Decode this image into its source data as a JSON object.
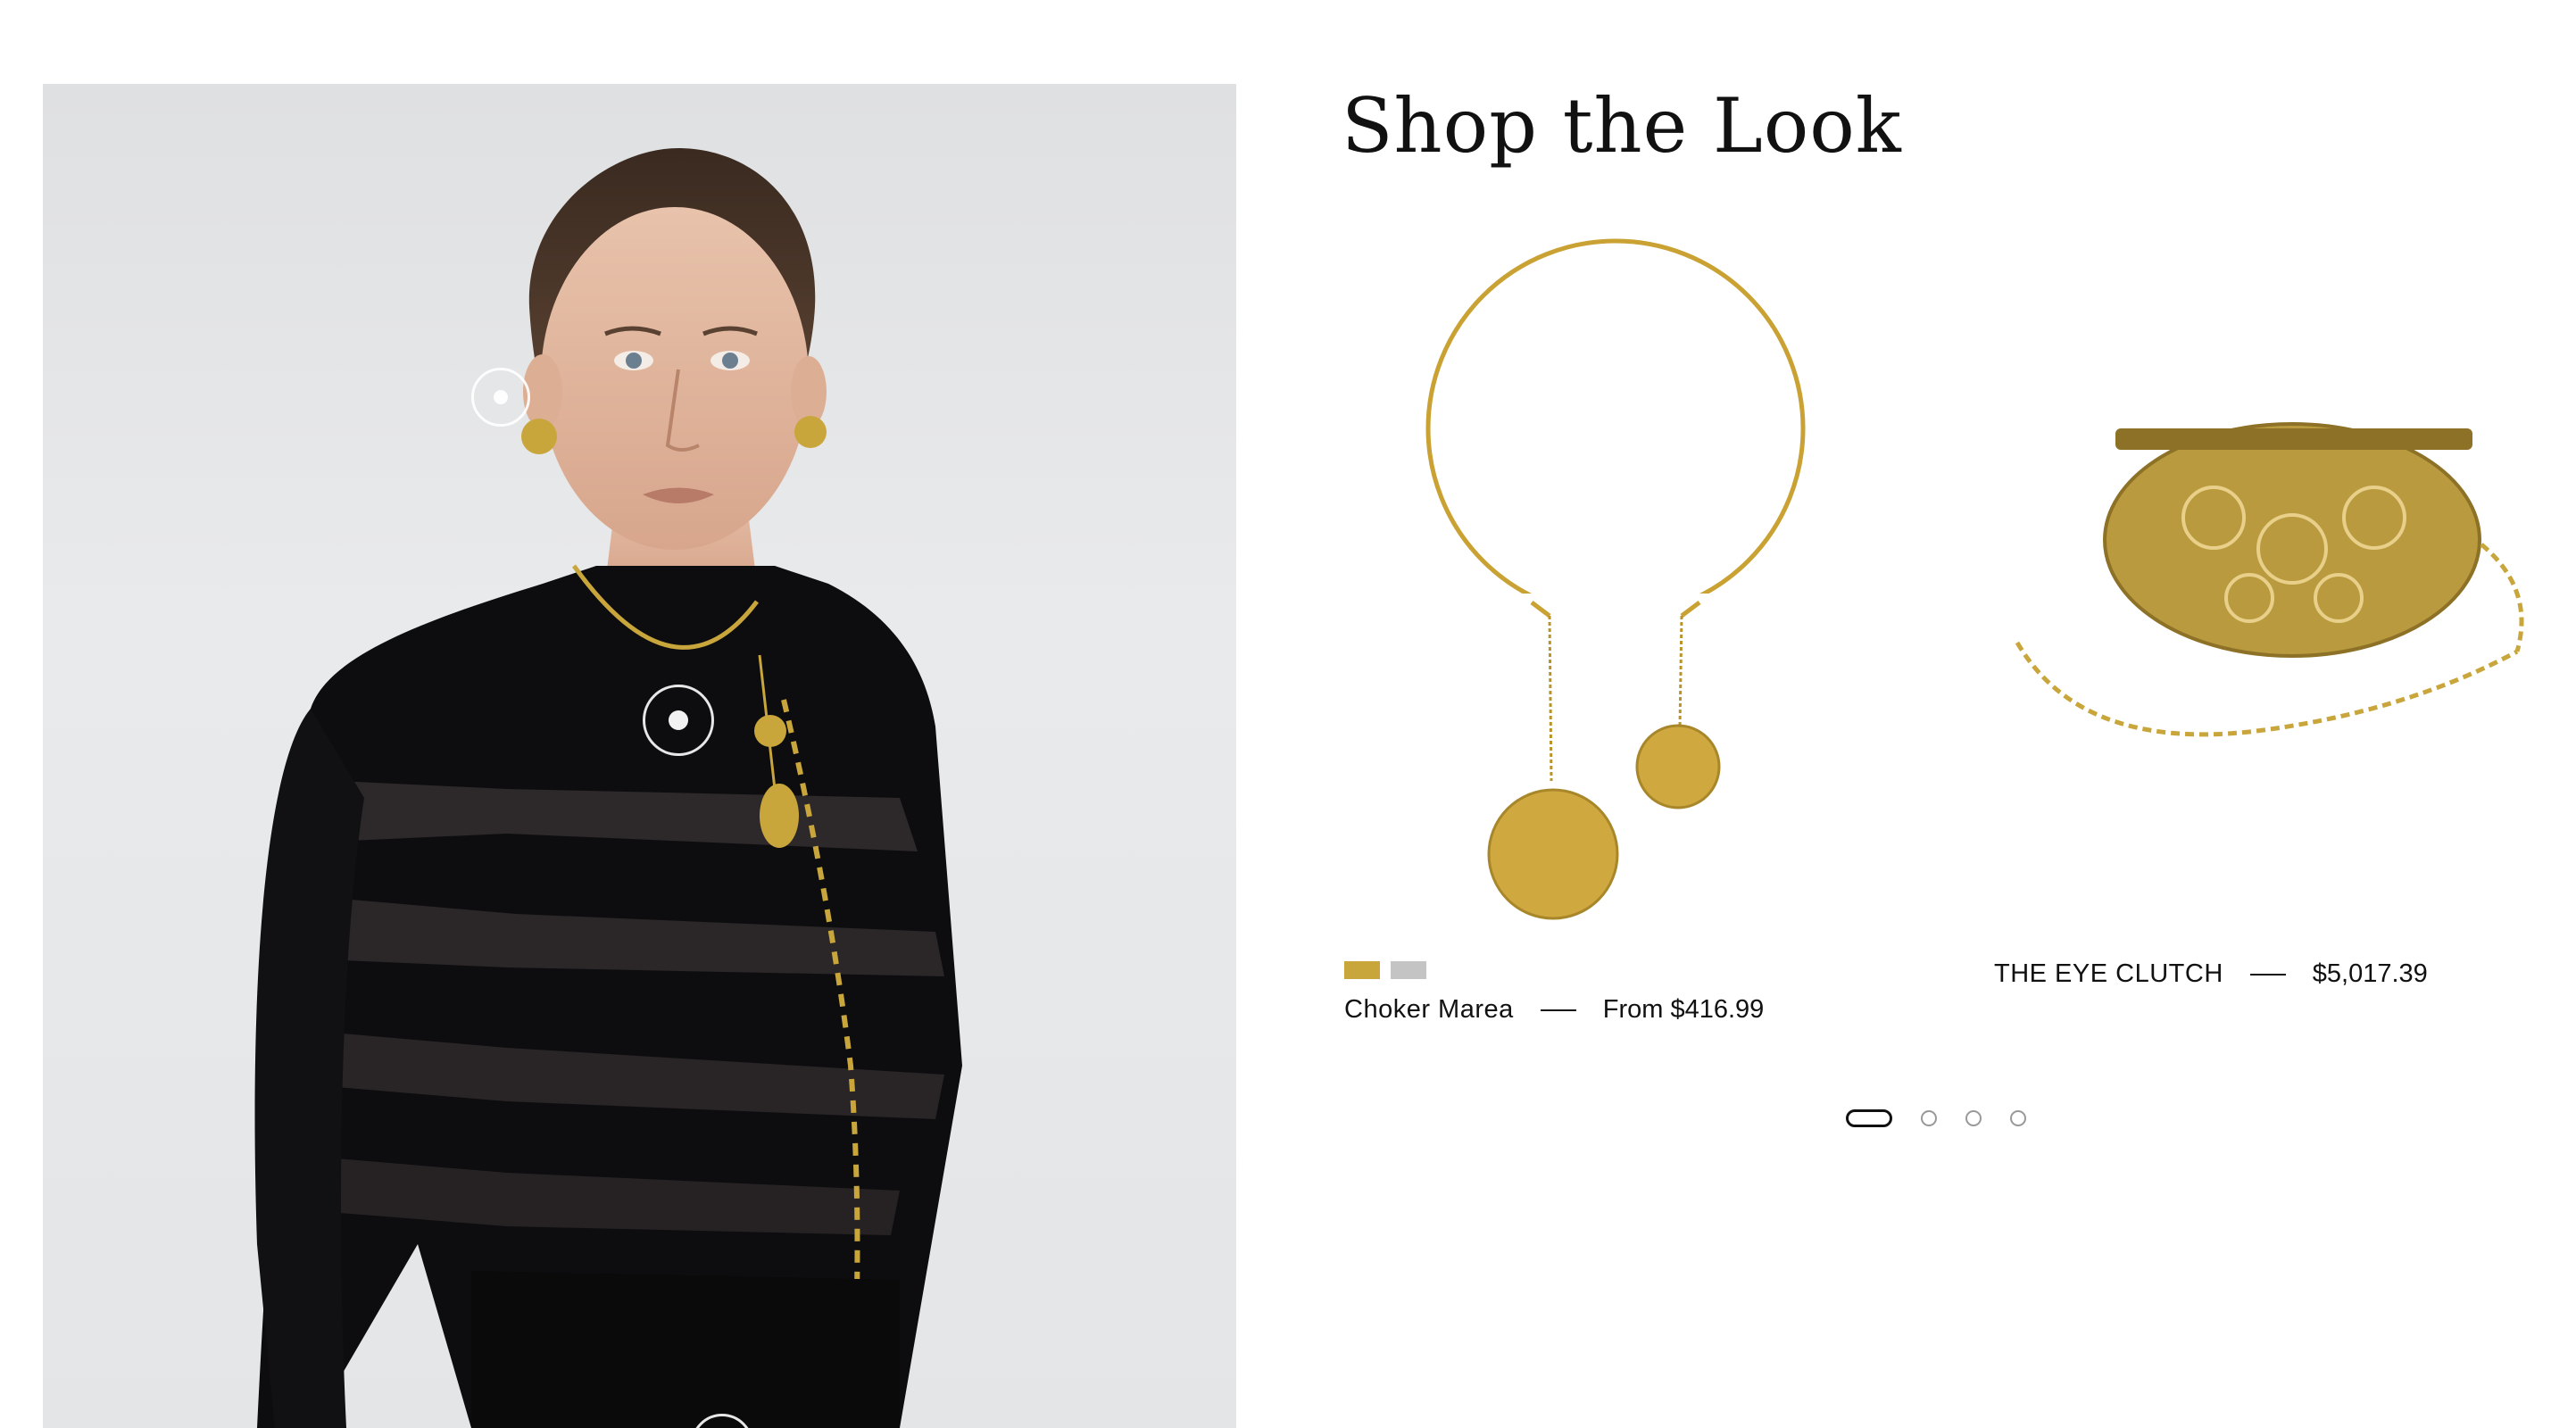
{
  "section": {
    "title": "Shop the Look"
  },
  "hero": {
    "hotspots": [
      {
        "name": "earring"
      },
      {
        "name": "choker"
      },
      {
        "name": "belt"
      }
    ]
  },
  "products": [
    {
      "name": "Choker Marea",
      "price": "From $416.99",
      "swatches": [
        {
          "label": "gold",
          "color": "#c9a63c"
        },
        {
          "label": "silver",
          "color": "#c4c4c4"
        }
      ]
    },
    {
      "name": "THE EYE CLUTCH",
      "price": "$5,017.39",
      "swatches": []
    }
  ],
  "pagination": {
    "total": 4,
    "current": 1
  },
  "colors": {
    "gold": "#c9a63c",
    "text": "#111111",
    "garment": "#0d0d0f"
  }
}
